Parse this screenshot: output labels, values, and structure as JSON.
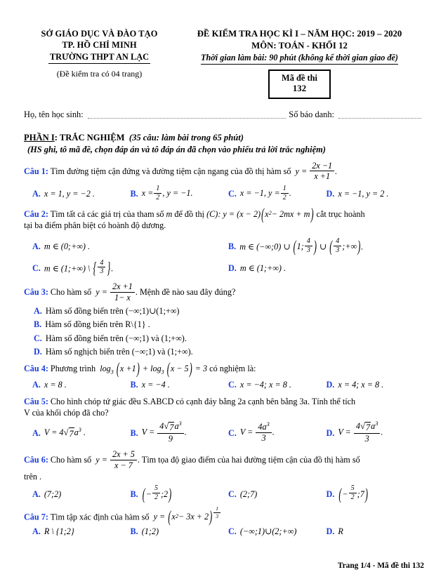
{
  "header": {
    "left": {
      "line1": "SỞ GIÁO DỤC VÀ ĐÀO TẠO",
      "line2": "TP. HỒ CHÍ MINH",
      "line3": "TRƯỜNG THPT AN LẠC",
      "line4": "(Đề kiểm tra có 04 trang)"
    },
    "right": {
      "line1": "ĐỀ KIỂM TRA HỌC KÌ I – NĂM HỌC: 2019 – 2020",
      "line2": "MÔN: TOÁN  - KHỐI 12",
      "line3": "Thời gian làm bài: 90 phút (không kể thời gian giao đề)"
    },
    "exam_code": {
      "label": "Mã đề thi",
      "value": "132"
    },
    "student": {
      "name_label": "Họ, tên học sinh:",
      "id_label": "Số báo danh:"
    }
  },
  "part": {
    "title_main": "PHẦN I",
    "title_rest": ": TRẮC NGHIỆM",
    "title_note": "(35 câu: làm bài trong 65 phút)",
    "subtitle": "(HS ghi, tô mã đề, chọn đáp án và tô đáp án đã chọn vào phiếu trả lời trắc nghiệm)"
  },
  "questions": [
    {
      "label": "Câu 1:",
      "text_before": "Tìm đường tiệm cận đứng và đường tiệm cận ngang của đồ thị hàm số",
      "formula": "y = (2x−1)/(x+1)",
      "options": [
        "A.",
        "B.",
        "C.",
        "D."
      ],
      "opt_a": "x = 1, y = −2 .",
      "opt_b_pre": "x =",
      "opt_b_post": ", y = −1.",
      "opt_c_pre": "x = −1, y =",
      "opt_c_post": ".",
      "opt_d": "x = −1, y = 2 ."
    },
    {
      "label": "Câu 2:",
      "text1": "Tìm tất cả các giá trị của tham số",
      "param": "m",
      "text2": "để đồ thị",
      "text3": "cắt trục hoành",
      "text4": "tại ba điểm phân biệt có hoành độ dương.",
      "opt_a": "m ∈ (0;+∞) .",
      "opt_b": "m ∈ (−∞;0) ∪ (1;4/3) ∪ (4/3;+∞).",
      "opt_c": "m ∈ (1;+∞) \\ {4/3} .",
      "opt_d": "m ∈ (1;+∞) ."
    },
    {
      "label": "Câu 3:",
      "text_before": "Cho hàm số",
      "text_after": ". Mệnh đề nào sau đây đúng?",
      "opt_a": "Hàm số đồng biến trên (−∞;1)∪(1;+∞)",
      "opt_b": "Hàm số đồng biến trên R\\{1} .",
      "opt_c": "Hàm số đồng biến trên (−∞;1) và (1;+∞).",
      "opt_d": "Hàm số nghịch biến trên (−∞;1) và (1;+∞)."
    },
    {
      "label": "Câu 4:",
      "text_before": "Phương trình",
      "text_after": "có nghiệm là:",
      "opt_a": "x = 8 .",
      "opt_b": "x = −4 .",
      "opt_c": "x = −4;  x = 8 .",
      "opt_d": "x = 4;  x = 8 ."
    },
    {
      "label": "Câu 5:",
      "text1": "Cho hình chóp tứ giác đều S.ABCD có cạnh đáy bằng 2a cạnh bên bằng 3a. Tính thể tích",
      "text2": "V của khối chóp đã cho?",
      "opt_a": "V = 4√7a³ .",
      "opt_b": "V = 4√7a³/9 .",
      "opt_c": "V = 4a³/3 .",
      "opt_d": "V = 4√7a³/3 ."
    },
    {
      "label": "Câu 6:",
      "text_before": "Cho hàm số",
      "text_after": ". Tìm tọa độ giao điểm của hai đường tiệm cận của đồ thị hàm số",
      "text2": "trên .",
      "opt_a": "(7;2)",
      "opt_b": "(−5/2;2)",
      "opt_c": "(2;7)",
      "opt_d": "(−5/2;7)"
    },
    {
      "label": "Câu 7:",
      "text_before": "Tìm tập xác định của hàm số",
      "opt_a": "R \\ {1;2}",
      "opt_b": "(1;2)",
      "opt_c": "(−∞;1)∪(2;+∞)",
      "opt_d": "R"
    }
  ],
  "footer": {
    "text": "Trang 1/4 - Mã đề thi 132"
  },
  "colors": {
    "label_blue": "#1a3cdc",
    "text_black": "#000000"
  }
}
